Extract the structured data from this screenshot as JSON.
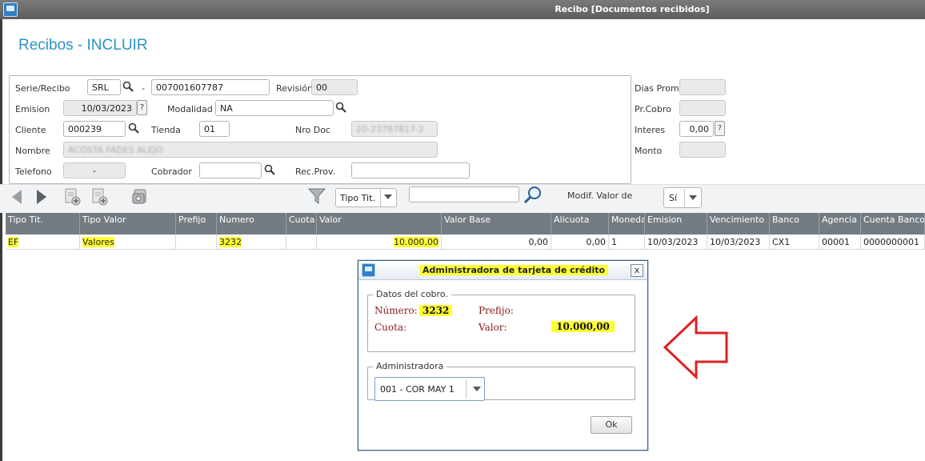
{
  "window": {
    "title": "Recibo [Documentos recibidos]"
  },
  "page": {
    "title": "Recibos - INCLUIR"
  },
  "form": {
    "serie_label": "Serie/Recibo",
    "serie_value": "SRL",
    "dash": "-",
    "recibo_value": "007001607787",
    "revision_label": "Revisión",
    "revision_value": "00",
    "emision_label": "Emision",
    "emision_value": "10/03/2023",
    "help_glyph": "?",
    "modalidad_label": "Modalidad",
    "modalidad_value": "NA",
    "cliente_label": "Cliente",
    "cliente_value": "000239",
    "tienda_label": "Tienda",
    "tienda_value": "01",
    "nrodoc_label": "Nro Doc",
    "nrodoc_value": "20-23787817-2",
    "nombre_label": "Nombre",
    "nombre_value": "ACOSTA FADES ALEJO",
    "telefono_label": "Telefono",
    "telefono_value": "-",
    "cobrador_label": "Cobrador",
    "cobrador_value": "",
    "recprov_label": "Rec.Prov.",
    "recprov_value": ""
  },
  "side": {
    "dias_prom_label": "Dias Prom.",
    "dias_prom_value": "",
    "prcobro_label": "Pr.Cobro",
    "prcobro_value": "",
    "interes_label": "Interes",
    "interes_value": "0,00",
    "monto_label": "Monto",
    "monto_value": ""
  },
  "toolbar": {
    "filter_select_value": "Tipo Tit.",
    "search_value": "",
    "modif_label": "Modif. Valor de",
    "modif_value": "Sí"
  },
  "grid": {
    "columns": [
      "Tipo Tit.",
      "Tipo Valor",
      "Prefijo",
      "Numero",
      "Cuota",
      "Valor",
      "Valor Base",
      "Alicuota",
      "Moneda",
      "Emision",
      "Vencimiento",
      "Banco",
      "Agencia",
      "Cuenta Banco"
    ],
    "row": [
      "EF",
      "Valores",
      "",
      "3232",
      "",
      "10.000,00",
      "0,00",
      "0,00",
      "1",
      "10/03/2023",
      "10/03/2023",
      "CX1",
      "00001",
      "0000000001"
    ]
  },
  "dialog": {
    "title": "Administradora de tarjeta de crédito",
    "close_glyph": "x",
    "group1_label": "Datos del cobro.",
    "numero_label": "Número:",
    "numero_value": "3232",
    "prefijo_label": "Prefijo:",
    "prefijo_value": "",
    "cuota_label": "Cuota:",
    "cuota_value": "",
    "valor_label": "Valor:",
    "valor_value": "10.000,00",
    "group2_label": "Administradora",
    "admin_value": "001 - COR MAY 1",
    "ok_label": "Ok"
  },
  "colors": {
    "title_accent": "#2a94c4",
    "highlight": "#ffff33",
    "grid_header": "#747c82",
    "annotation_arrow": "#e02020"
  }
}
